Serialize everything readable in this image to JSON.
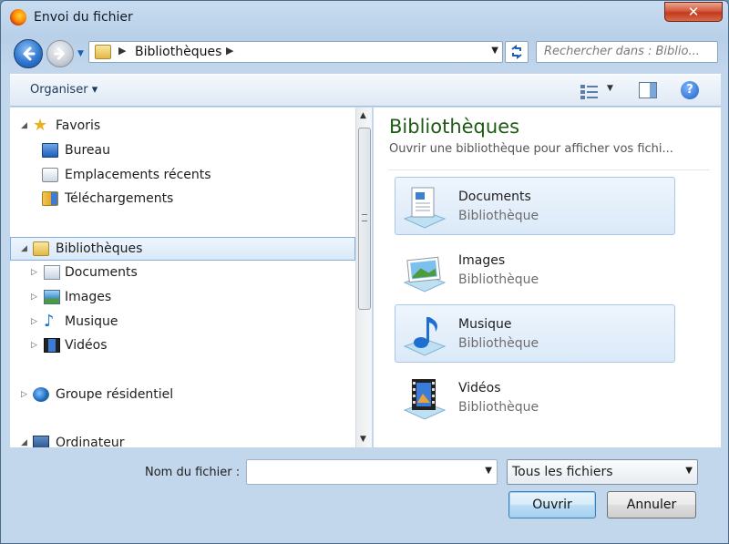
{
  "window": {
    "title": "Envoi du fichier",
    "close_glyph": "✕"
  },
  "nav": {
    "address_path": "Bibliothèques",
    "address_separator": "▶",
    "search_placeholder": "Rechercher dans : Biblio..."
  },
  "toolbar": {
    "organiser_label": "Organiser",
    "organiser_arrow": "▾",
    "help_glyph": "?"
  },
  "nav_pane": {
    "items": [
      {
        "label": "Favoris",
        "icon": "star-icon",
        "level": 0,
        "expanded": true
      },
      {
        "label": "Bureau",
        "icon": "desktop-icon",
        "level": 1
      },
      {
        "label": "Emplacements récents",
        "icon": "recent-places-icon",
        "level": 1
      },
      {
        "label": "Téléchargements",
        "icon": "downloads-icon",
        "level": 1
      },
      {
        "label": "Bibliothèques",
        "icon": "library-icon",
        "level": 0,
        "expanded": true,
        "selected": true
      },
      {
        "label": "Documents",
        "icon": "documents-icon",
        "level": 1,
        "expandable": true
      },
      {
        "label": "Images",
        "icon": "images-icon",
        "level": 1,
        "expandable": true
      },
      {
        "label": "Musique",
        "icon": "music-icon",
        "level": 1,
        "expandable": true
      },
      {
        "label": "Vidéos",
        "icon": "video-icon",
        "level": 1,
        "expandable": true
      },
      {
        "label": "Groupe résidentiel",
        "icon": "homegroup-icon",
        "level": 0,
        "expandable": true
      },
      {
        "label": "Ordinateur",
        "icon": "computer-icon",
        "level": 0,
        "expanded": true
      }
    ]
  },
  "content": {
    "title": "Bibliothèques",
    "subtitle": "Ouvrir une bibliothèque pour afficher vos fichi...",
    "libraries": [
      {
        "name": "Documents",
        "type": "Bibliothèque",
        "icon": "documents-library-icon",
        "highlighted": true
      },
      {
        "name": "Images",
        "type": "Bibliothèque",
        "icon": "images-library-icon",
        "highlighted": false
      },
      {
        "name": "Musique",
        "type": "Bibliothèque",
        "icon": "music-library-icon",
        "highlighted": true
      },
      {
        "name": "Vidéos",
        "type": "Bibliothèque",
        "icon": "videos-library-icon",
        "highlighted": false
      }
    ]
  },
  "footer": {
    "filename_label": "Nom du fichier :",
    "filename_value": "",
    "filetype_selected": "Tous les fichiers",
    "open_label": "Ouvrir",
    "cancel_label": "Annuler"
  },
  "colors": {
    "accent": "#3c7fb1",
    "title_green": "#1e5b14",
    "selection_border": "#84acdd"
  }
}
